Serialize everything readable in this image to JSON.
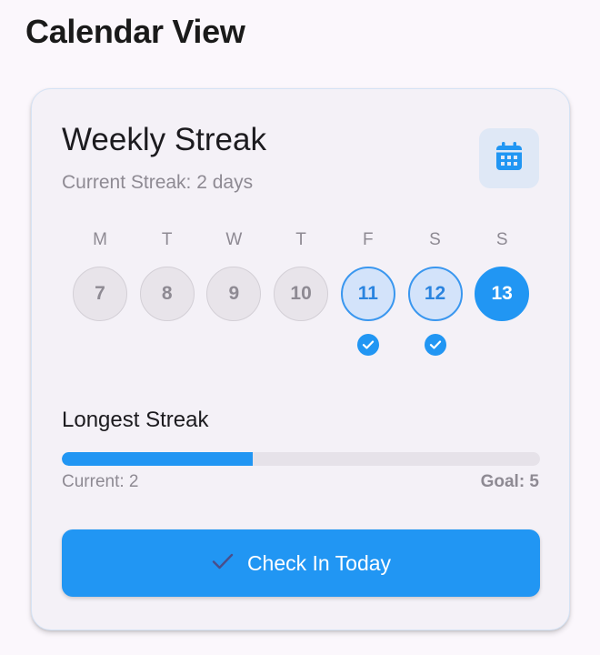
{
  "page": {
    "title": "Calendar View"
  },
  "card": {
    "title": "Weekly Streak",
    "subtitle": "Current Streak: 2 days",
    "calendar_icon": "calendar-icon"
  },
  "week": [
    {
      "letter": "M",
      "date": "7",
      "state": "past"
    },
    {
      "letter": "T",
      "date": "8",
      "state": "past"
    },
    {
      "letter": "W",
      "date": "9",
      "state": "past"
    },
    {
      "letter": "T",
      "date": "10",
      "state": "past"
    },
    {
      "letter": "F",
      "date": "11",
      "state": "checked"
    },
    {
      "letter": "S",
      "date": "12",
      "state": "checked"
    },
    {
      "letter": "S",
      "date": "13",
      "state": "today"
    }
  ],
  "longest": {
    "title": "Longest Streak",
    "current_label": "Current: 2",
    "goal_label": "Goal: 5",
    "progress_fraction": 0.4
  },
  "button": {
    "label": "Check In Today",
    "icon": "check-icon"
  },
  "colors": {
    "accent": "#2196f3",
    "card_bg": "#f4f1f7",
    "muted_text": "#8e8a93"
  }
}
